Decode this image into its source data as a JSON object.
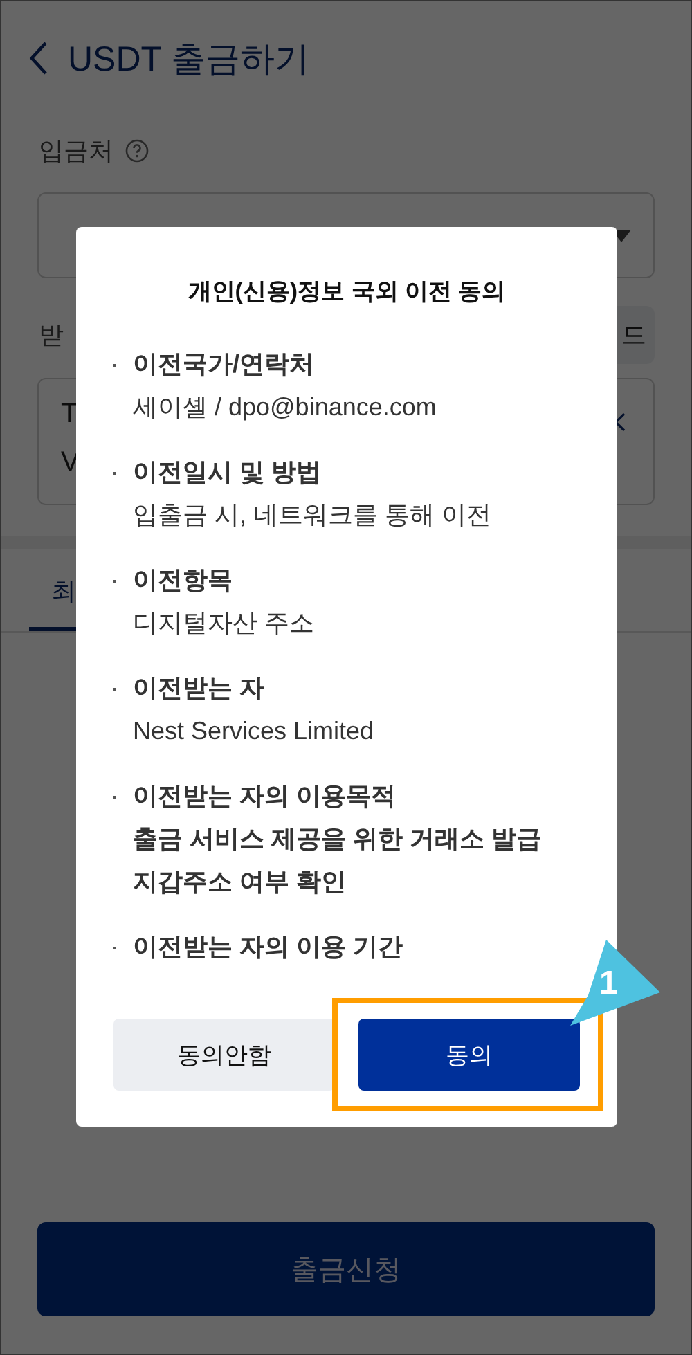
{
  "header": {
    "title": "USDT 출금하기"
  },
  "deposit": {
    "label": "입금처"
  },
  "address": {
    "label": "받",
    "action": "드",
    "lines": [
      "T",
      "V"
    ]
  },
  "tabs": [
    {
      "label": "최",
      "selected": true
    }
  ],
  "submit_button": {
    "label": "출금신청",
    "disabled": true
  },
  "dialog": {
    "title": "개인(신용)정보 국외 이전 동의",
    "items": [
      {
        "heading": "이전국가/연락처",
        "lines": [
          "세이셸 / dpo@binance.com"
        ],
        "bold_lines": false
      },
      {
        "heading": "이전일시 및 방법",
        "lines": [
          "입출금 시, 네트워크를 통해 이전"
        ],
        "bold_lines": false
      },
      {
        "heading": "이전항목",
        "lines": [
          "디지털자산 주소"
        ],
        "bold_lines": false
      },
      {
        "heading": "이전받는 자",
        "lines": [
          "Nest Services Limited"
        ],
        "bold_lines": false
      },
      {
        "heading": "이전받는 자의 이용목적",
        "lines": [
          "출금 서비스 제공을 위한 거래소 발급",
          "지갑주소 여부 확인"
        ],
        "bold_lines": true
      },
      {
        "heading": "이전받는 자의 이용 기간"
      }
    ],
    "buttons": [
      {
        "label": "동의안함",
        "kind": "secondary"
      },
      {
        "label": "동의",
        "kind": "primary"
      }
    ]
  },
  "annotation": {
    "step": "1"
  }
}
